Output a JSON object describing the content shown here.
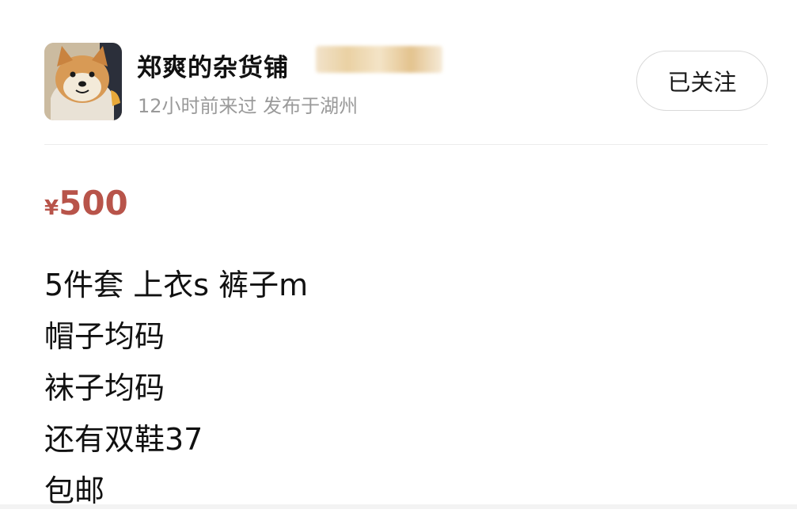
{
  "seller": {
    "name": "郑爽的杂货铺",
    "meta": "12小时前来过 发布于湖州"
  },
  "follow_button": {
    "label": "已关注"
  },
  "price": {
    "symbol": "¥",
    "value": "500"
  },
  "description": {
    "lines": [
      "5件套 上衣s 裤子m",
      "帽子均码",
      "袜子均码",
      "还有双鞋37",
      "包邮"
    ]
  },
  "colors": {
    "price": "#b8544a",
    "meta_text": "#9a9a9a",
    "divider": "#ececec"
  },
  "icons": {
    "avatar": "shiba-dog-avatar"
  }
}
